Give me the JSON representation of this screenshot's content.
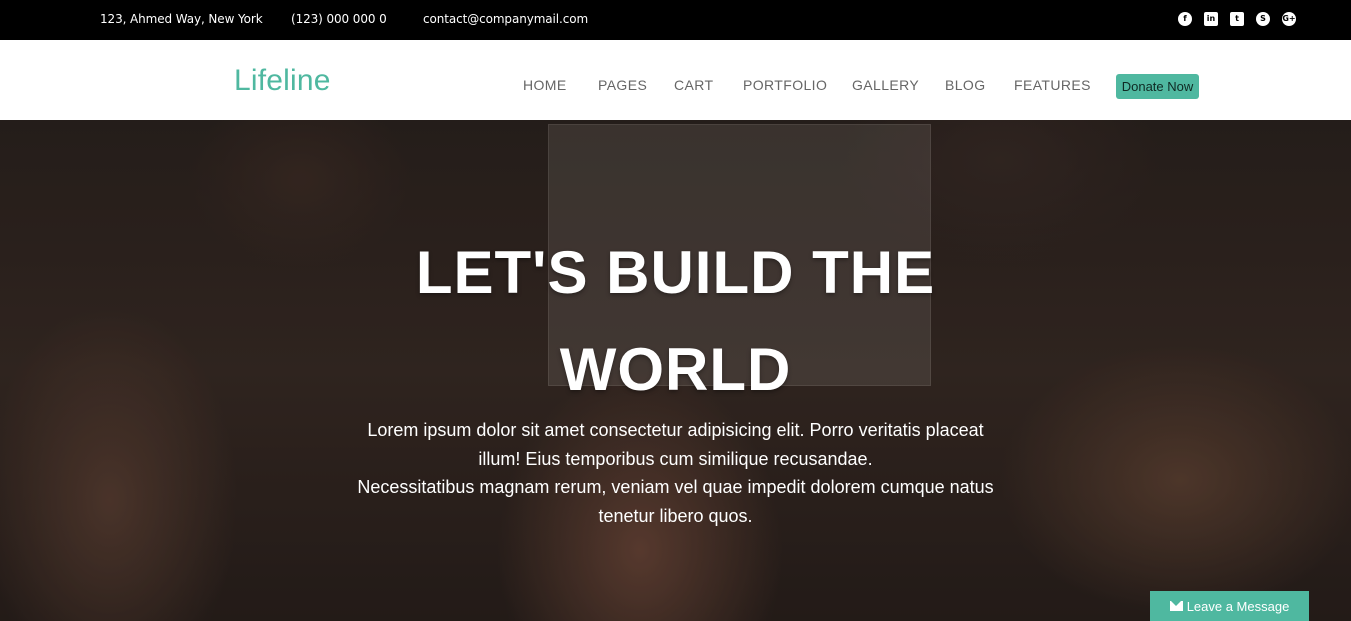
{
  "topbar": {
    "address": "123, Ahmed Way, New York",
    "phone": "(123) 000 000 0",
    "email": "contact@companymail.com",
    "social": [
      {
        "name": "facebook-icon",
        "glyph": "f"
      },
      {
        "name": "linkedin-icon",
        "glyph": "in"
      },
      {
        "name": "twitter-icon",
        "glyph": "t"
      },
      {
        "name": "skype-icon",
        "glyph": "S"
      },
      {
        "name": "google-plus-icon",
        "glyph": "G+"
      }
    ]
  },
  "navbar": {
    "logo": "Lifeline",
    "items": [
      "HOME",
      "PAGES",
      "CART",
      "PORTFOLIO",
      "GALLERY",
      "BLOG",
      "FEATURES"
    ],
    "donate_label": "Donate Now"
  },
  "hero": {
    "title_line1": "LET'S BUILD THE",
    "title_line2": "WORLD",
    "text_line1": "Lorem ipsum dolor sit amet consectetur adipisicing elit. Porro veritatis placeat",
    "text_line2": "illum! Eius temporibus cum similique recusandae.",
    "text_line3": "Necessitatibus magnam rerum, veniam vel quae impedit dolorem cumque natus",
    "text_line4": "tenetur libero quos."
  },
  "chat": {
    "label": "Leave a Message"
  },
  "colors": {
    "accent": "#4fb8a0",
    "topbar_bg": "#000000",
    "navbar_bg": "#ffffff"
  }
}
